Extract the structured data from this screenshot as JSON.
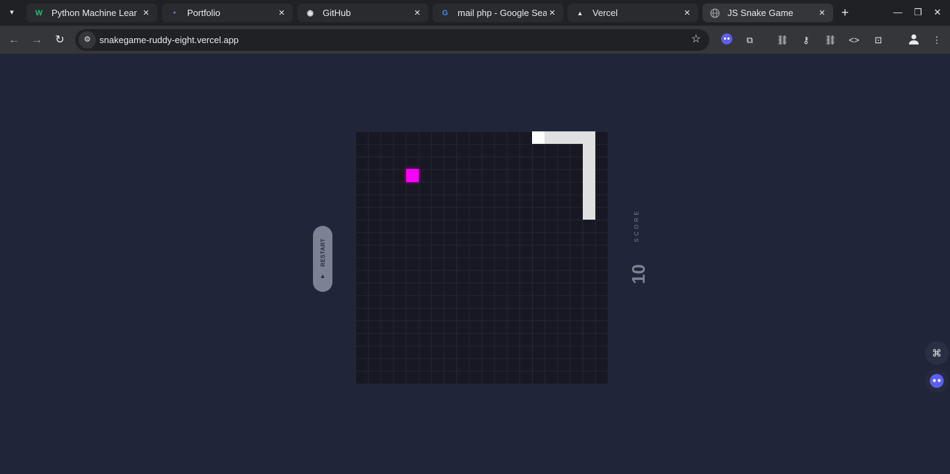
{
  "tabs": [
    {
      "title": "Python Machine Lear",
      "favicon": "W",
      "favicon_color": "#21c07a",
      "active": false
    },
    {
      "title": "Portfolio",
      "favicon": "●",
      "favicon_color": "#8a6cf0",
      "active": false
    },
    {
      "title": "GitHub",
      "favicon": "◉",
      "favicon_color": "#e8eaed",
      "active": false
    },
    {
      "title": "mail php - Google Sea",
      "favicon": "G",
      "favicon_color": "#4285f4",
      "active": false
    },
    {
      "title": "Vercel",
      "favicon": "▲",
      "favicon_color": "#e8eaed",
      "active": false
    },
    {
      "title": "JS Snake Game",
      "favicon": "🌐",
      "favicon_color": "#9aa0a6",
      "active": true
    }
  ],
  "toolbar": {
    "url": "snakegame-ruddy-eight.vercel.app"
  },
  "game": {
    "restart_label": "RESTART",
    "score_label": "SCORE",
    "score_value": "10",
    "grid_size": 20,
    "food": {
      "col": 4,
      "row": 3
    },
    "snake": [
      {
        "col": 14,
        "row": 0
      },
      {
        "col": 15,
        "row": 0
      },
      {
        "col": 16,
        "row": 0
      },
      {
        "col": 17,
        "row": 0
      },
      {
        "col": 18,
        "row": 0
      },
      {
        "col": 18,
        "row": 1
      },
      {
        "col": 18,
        "row": 2
      },
      {
        "col": 18,
        "row": 3
      },
      {
        "col": 18,
        "row": 4
      },
      {
        "col": 18,
        "row": 5
      },
      {
        "col": 18,
        "row": 6
      }
    ],
    "colors": {
      "food": "#ff00ff",
      "snake": "#e0e0e0",
      "board": "#181824",
      "background": "#21253a"
    }
  },
  "icons": [
    "tab-list-icon",
    "new-tab-icon",
    "minimize-icon",
    "restore-icon",
    "close-window-icon",
    "back-icon",
    "forward-icon",
    "reload-icon",
    "site-info-icon",
    "bookmark-star-icon",
    "extension-icon",
    "puzzle-icon",
    "incognito-icon",
    "key-icon",
    "link-icon",
    "code-icon",
    "screenshot-icon",
    "profile-icon",
    "menu-icon"
  ]
}
